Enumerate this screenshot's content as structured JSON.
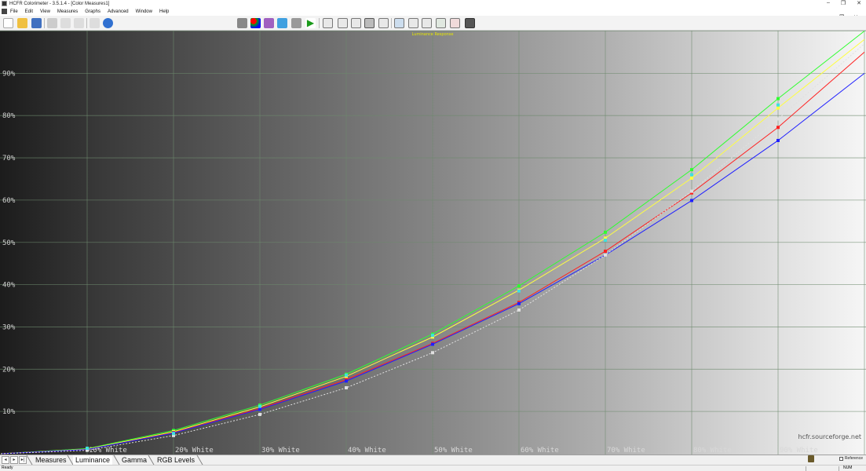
{
  "window": {
    "title": "HCFR Colorimeter - 3.5.1.4 - [Color Measures1]",
    "controls": [
      "–",
      "❐",
      "✕"
    ]
  },
  "menu": {
    "items": [
      "File",
      "Edit",
      "View",
      "Measures",
      "Graphs",
      "Advanced",
      "Window",
      "Help"
    ],
    "mdi_controls": [
      "–",
      "❐",
      "✕"
    ]
  },
  "toolbar": {
    "left_icons": [
      "new-icon",
      "open-icon",
      "save-icon",
      "cut-icon",
      "copy-icon",
      "paste-icon",
      "undo-icon",
      "help-icon"
    ],
    "center_icons": [
      "sensor-icon",
      "rgb-icon",
      "generator-icon",
      "pattern-icon",
      "camera-icon",
      "play-icon",
      "view1-icon",
      "view2-icon",
      "view3-icon",
      "view4-icon",
      "view5-icon",
      "view6-icon",
      "view7-icon",
      "view8-icon",
      "view9-icon",
      "view10-icon",
      "view11-icon"
    ]
  },
  "chart_data": {
    "type": "line",
    "title": "Luminance Response",
    "categories": [
      "0% White",
      "10% White",
      "20% White",
      "30% White",
      "40% White",
      "50% White",
      "60% White",
      "70% White",
      "80% White",
      "90% White",
      "100% White"
    ],
    "x_labels": [
      "10% White",
      "20% White",
      "30% White",
      "40% White",
      "50% White",
      "60% White",
      "70% White",
      "80% White",
      "90% White"
    ],
    "y_labels": [
      "10%",
      "20%",
      "30%",
      "40%",
      "50%",
      "60%",
      "70%",
      "80%",
      "90%"
    ],
    "ylim": [
      0,
      100
    ],
    "grid": true,
    "watermark": "hcfr.sourceforge.net",
    "series": [
      {
        "color": "#30ff30",
        "style": "solid",
        "values": [
          0,
          1.2,
          5.5,
          11.5,
          18.8,
          28.3,
          39.7,
          52.4,
          67.2,
          84,
          100
        ]
      },
      {
        "color": "#ffff40",
        "style": "solid",
        "values": [
          0,
          1.1,
          5.2,
          11.1,
          18.3,
          27.6,
          38.7,
          51,
          65.2,
          81.8,
          98
        ]
      },
      {
        "color": "#ff2020",
        "style": "solid",
        "values": [
          0,
          1.0,
          5.0,
          10.7,
          17.5,
          26.1,
          35.8,
          47.9,
          61.7,
          77.2,
          95
        ]
      },
      {
        "color": "#2020ff",
        "style": "solid",
        "values": [
          0,
          1.0,
          4.9,
          10.5,
          17.2,
          25.9,
          35.5,
          47.0,
          59.9,
          74.1,
          90
        ]
      },
      {
        "color": "#e0e0e0",
        "style": "dashed",
        "values": [
          0,
          0.8,
          4.3,
          9.3,
          15.6,
          23.9,
          34.0,
          47.0,
          62.1,
          79.2,
          97
        ]
      }
    ],
    "markers": {
      "cyan": [
        1.3,
        4.8,
        11.2,
        18.6,
        28,
        38.5,
        50.5,
        66,
        82.5
      ]
    }
  },
  "tabs": {
    "nav": [
      "◂",
      "▸",
      "▸|"
    ],
    "items": [
      "Measures",
      "Luminance",
      "Gamma",
      "RGB Levels"
    ],
    "active": "Luminance",
    "reference_label": "Reference"
  },
  "status": {
    "left": "Ready",
    "right": "NUM"
  }
}
